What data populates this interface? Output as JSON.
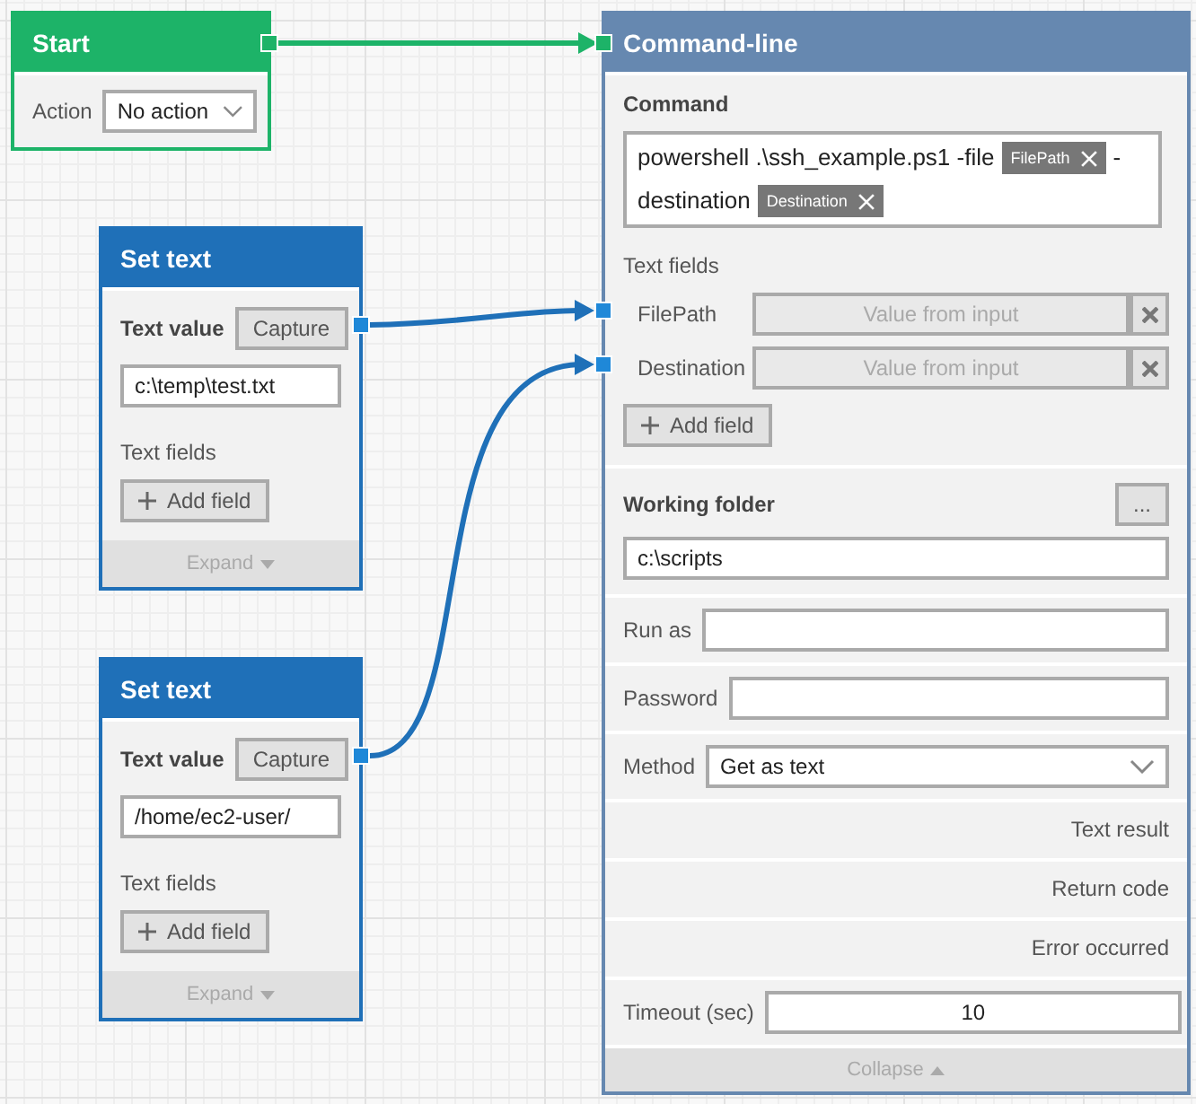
{
  "start_node": {
    "title": "Start",
    "action_label": "Action",
    "action_value": "No action"
  },
  "set_text_nodes": [
    {
      "title": "Set text",
      "text_value_label": "Text value",
      "capture_button": "Capture",
      "value": "c:\\temp\\test.txt",
      "text_fields_label": "Text fields",
      "add_field_button": "Add field",
      "footer": "Expand",
      "expanded": false
    },
    {
      "title": "Set text",
      "text_value_label": "Text value",
      "capture_button": "Capture",
      "value": "/home/ec2-user/",
      "text_fields_label": "Text fields",
      "add_field_button": "Add field",
      "footer": "Expand",
      "expanded": false
    }
  ],
  "command_node": {
    "title": "Command-line",
    "command_label": "Command",
    "command": [
      {
        "kind": "text",
        "text": "powershell .\\ssh_example.ps1 -file"
      },
      {
        "kind": "token",
        "text": "FilePath"
      },
      {
        "kind": "text",
        "text": "-"
      },
      {
        "kind": "text",
        "text": "destination"
      },
      {
        "kind": "token",
        "text": "Destination"
      }
    ],
    "text_fields_label": "Text fields",
    "text_fields": [
      {
        "name": "FilePath",
        "placeholder": "Value from input",
        "disabled": true
      },
      {
        "name": "Destination",
        "placeholder": "Value from input",
        "disabled": true
      }
    ],
    "add_field_button": "Add field",
    "working_folder": {
      "label": "Working folder",
      "browse_button": "...",
      "value": "c:\\scripts"
    },
    "run_as": {
      "label": "Run as"
    },
    "password": {
      "label": "Password"
    },
    "method": {
      "label": "Method",
      "value": "Get as text"
    },
    "outputs": [
      "Text result",
      "Return code",
      "Error occurred"
    ],
    "timeout": {
      "label": "Timeout (sec)",
      "value": "10"
    },
    "footer": "Collapse",
    "expanded": true
  }
}
